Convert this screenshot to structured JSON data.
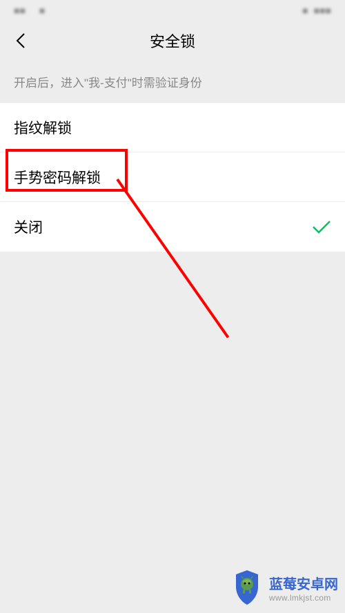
{
  "statusbar": {
    "left1": "■■",
    "left2": "■",
    "right1": "■",
    "right2": "■■■"
  },
  "header": {
    "title": "安全锁"
  },
  "description": "开启后，进入\"我-支付\"时需验证身份",
  "options": {
    "fingerprint": "指纹解锁",
    "gesture": "手势密码解锁",
    "close": "关闭"
  },
  "watermark": {
    "title": "蓝莓安卓网",
    "url": "www.lmkjst.com"
  }
}
